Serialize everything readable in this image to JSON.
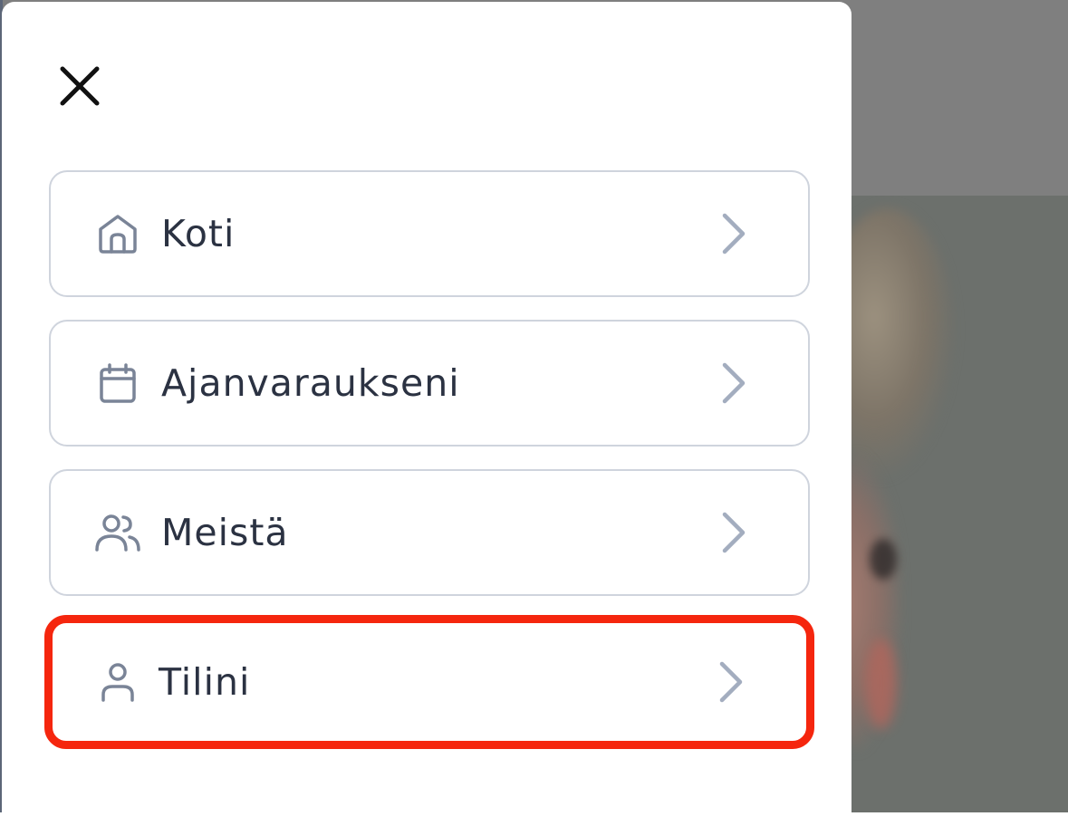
{
  "menu": {
    "close_icon": "close-icon",
    "items": [
      {
        "label": "Koti",
        "icon": "home-icon",
        "highlighted": false
      },
      {
        "label": "Ajanvaraukseni",
        "icon": "calendar-icon",
        "highlighted": false
      },
      {
        "label": "Meistä",
        "icon": "users-icon",
        "highlighted": false
      },
      {
        "label": "Tilini",
        "icon": "user-icon",
        "highlighted": true
      }
    ]
  },
  "colors": {
    "panel_background": "#ffffff",
    "item_border": "#cfd4dd",
    "highlight_border": "#f5260e",
    "label_text": "#2b3242",
    "icon_stroke": "#7a8497",
    "chevron_stroke": "#a3adbf",
    "overlay": "#7f7f7f"
  }
}
